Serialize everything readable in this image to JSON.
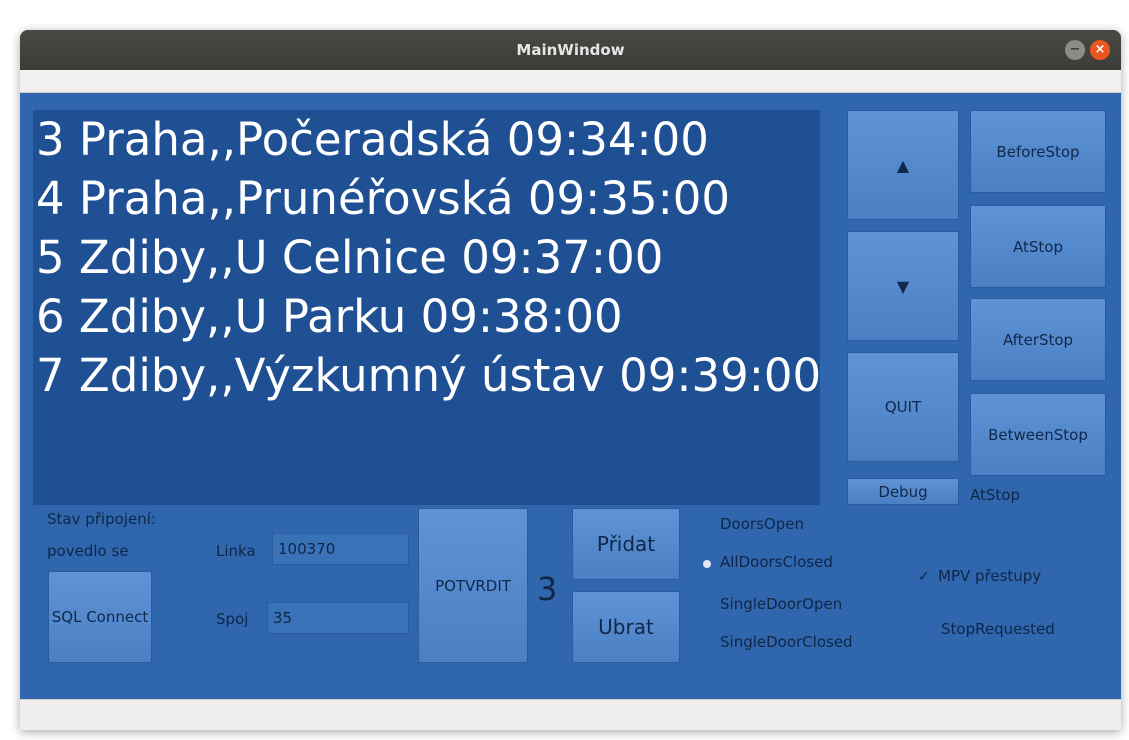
{
  "window": {
    "title": "MainWindow",
    "minimize_glyph": "−",
    "close_glyph": "×"
  },
  "stops": [
    "3 Praha,,Počeradská 09:34:00",
    "4 Praha,,Prunéřovská 09:35:00",
    "5 Zdiby,,U Celnice 09:37:00",
    "6 Zdiby,,U Parku 09:38:00",
    "7 Zdiby,,Výzkumný ústav 09:39:00"
  ],
  "nav": {
    "up_glyph": "▲",
    "down_glyph": "▼",
    "quit_label": "QUIT",
    "debug_label": "Debug"
  },
  "stop_state_buttons": {
    "before": "BeforeStop",
    "at": "AtStop",
    "after": "AfterStop",
    "between": "BetweenStop"
  },
  "current_state": "AtStop",
  "connection": {
    "status_label": "Stav připojení:",
    "status_value": "povedlo se",
    "connect_button": "SQL Connect"
  },
  "form": {
    "linka_label": "Linka",
    "linka_value": "100370",
    "spoj_label": "Spoj",
    "spoj_value": "35",
    "confirm_button": "POTVRDIT",
    "counter": "3",
    "add_button": "Přidat",
    "remove_button": "Ubrat"
  },
  "door_radios": {
    "options": [
      "DoorsOpen",
      "AllDoorsClosed",
      "SingleDoorOpen",
      "SingleDoorClosed"
    ],
    "selected": "AllDoorsClosed"
  },
  "checkboxes": {
    "mpv_label": "MPV přestupy",
    "mpv_checked": true,
    "stop_requested_label": "StopRequested",
    "stop_requested_checked": false,
    "check_glyph": "✓"
  },
  "colors": {
    "window_bg": "#2f66ad",
    "list_bg": "#1f5094",
    "button_bg": "#5889cf",
    "text_dark": "#0f2747"
  }
}
